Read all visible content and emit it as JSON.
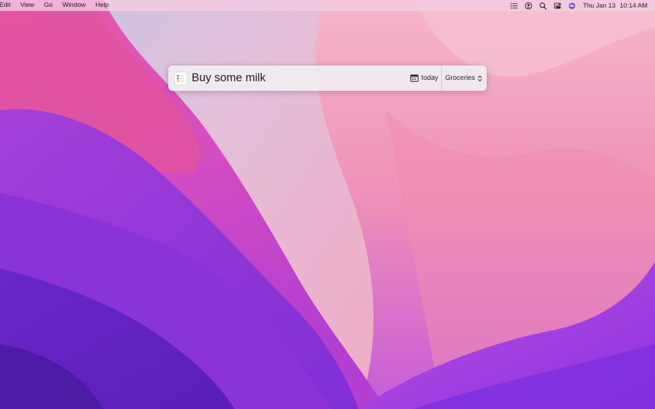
{
  "menubar": {
    "items": [
      "Edit",
      "View",
      "Go",
      "Window",
      "Help"
    ],
    "status_icons": [
      "list-icon",
      "user-icon",
      "search-icon",
      "control-center-icon",
      "siri-icon"
    ],
    "date": "Thu Jan 13",
    "time": "10:14 AM"
  },
  "quick_entry": {
    "app_icon": "reminders-icon",
    "input_value": "Buy some milk",
    "date_icon": "calendar-icon",
    "date_label": "today",
    "list_label": "Groceries",
    "list_selector_icon": "up-down-chevron-icon"
  },
  "colors": {
    "menubar": "#f5cde1",
    "panel": "#f0eaf0",
    "text": "#1d1d1f",
    "accent_red": "#ff3b30",
    "accent_orange": "#ff9500",
    "accent_blue": "#007aff"
  }
}
